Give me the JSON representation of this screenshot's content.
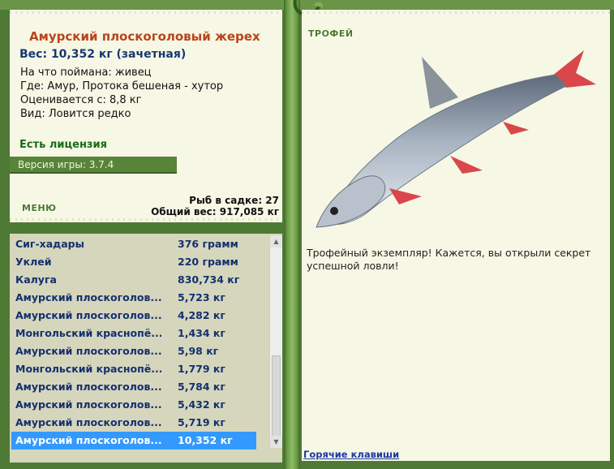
{
  "catch": {
    "name": "Амурский плоскоголовый жерех",
    "weight": "Вес: 10,352 кг (зачетная)",
    "bait": "На что поймана: живец",
    "location": "Где: Амур, Протока бешеная - хутор",
    "value": "Оценивается с: 8,8 кг",
    "kind": "Вид: Ловится редко"
  },
  "license": "Есть лицензия",
  "version": "Версия игры: 3.7.4",
  "menu": "МЕНЮ",
  "stats": {
    "fish_count": "Рыб в садке: 27",
    "total_weight": "Общий вес: 917,085 кг"
  },
  "trophy": {
    "title": "ТРОФЕЙ",
    "text": "Трофейный экземпляр! Кажется, вы открыли секрет успешной ловли!",
    "hotkeys": "Горячие клавиши"
  },
  "fish_list": [
    {
      "name": "Сиг-хадары",
      "weight": "376 грамм"
    },
    {
      "name": "Уклей",
      "weight": "220 грамм"
    },
    {
      "name": "Калуга",
      "weight": "830,734 кг"
    },
    {
      "name": "Амурский плоскоголов...",
      "weight": "5,723 кг"
    },
    {
      "name": "Амурский плоскоголов...",
      "weight": "4,282 кг"
    },
    {
      "name": "Монгольский краснопё...",
      "weight": "1,434 кг"
    },
    {
      "name": "Амурский плоскоголов...",
      "weight": "5,98 кг"
    },
    {
      "name": "Монгольский краснопё...",
      "weight": "1,779 кг"
    },
    {
      "name": "Амурский плоскоголов...",
      "weight": "5,784 кг"
    },
    {
      "name": "Амурский плоскоголов...",
      "weight": "5,432 кг"
    },
    {
      "name": "Амурский плоскоголов...",
      "weight": "5,719 кг"
    },
    {
      "name": "Амурский плоскоголов...",
      "weight": "10,352 кг"
    }
  ],
  "selected_index": 11
}
